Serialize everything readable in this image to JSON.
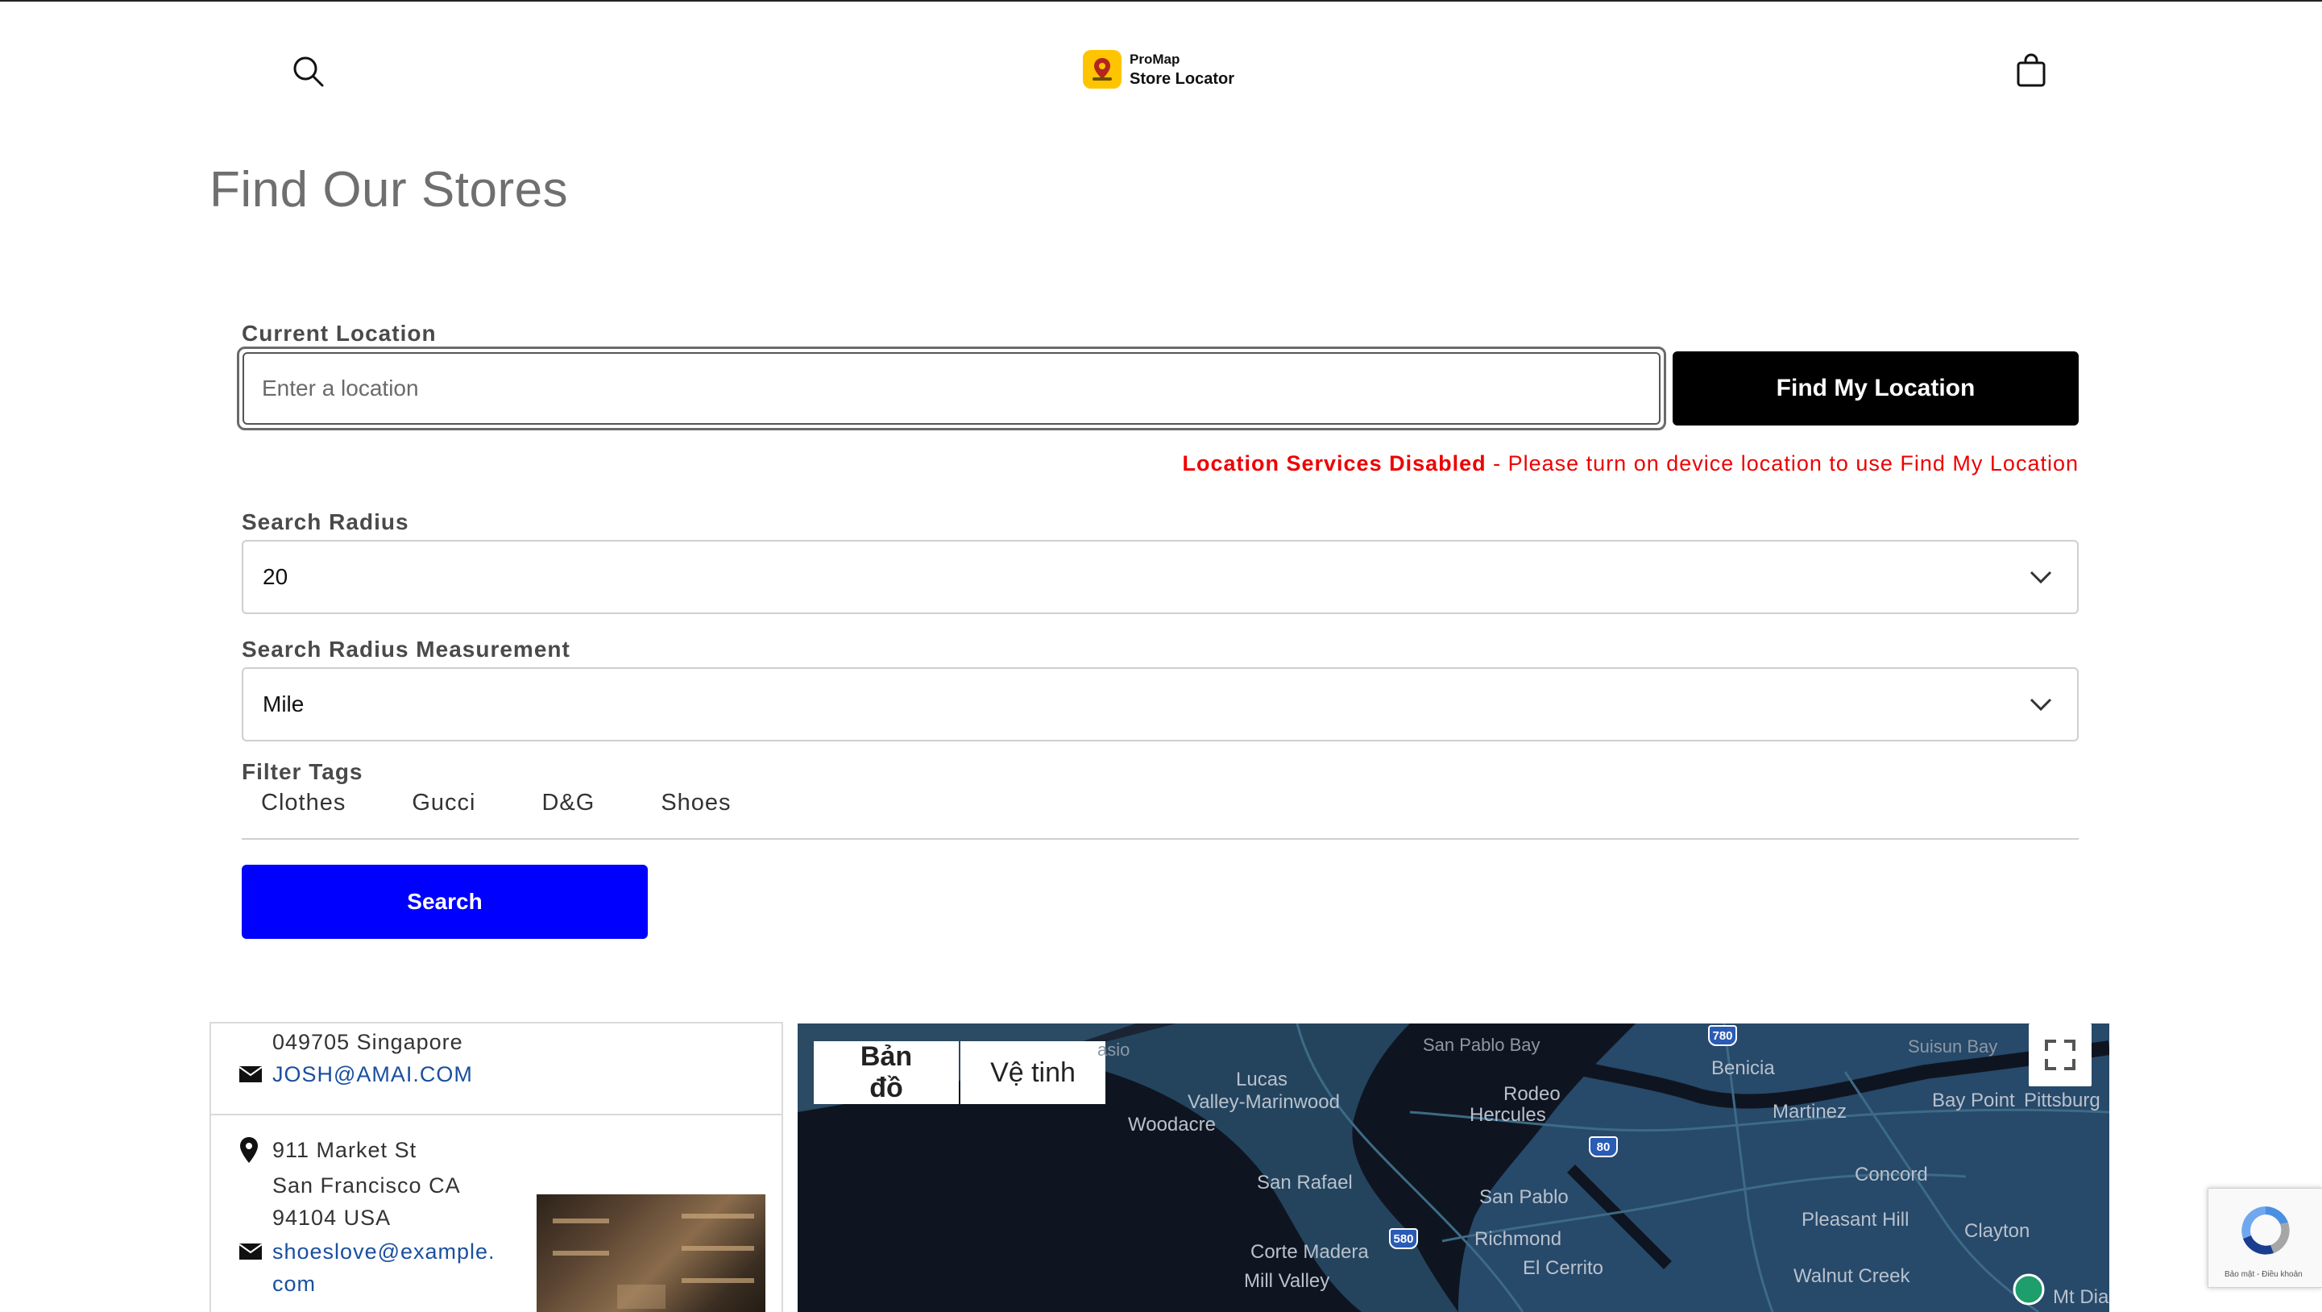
{
  "header": {
    "logo_brand": "ProMap",
    "logo_name": "Store Locator",
    "search_icon": "search-icon",
    "cart_icon": "cart-icon"
  },
  "page": {
    "title": "Find Our Stores"
  },
  "form": {
    "current_location_label": "Current Location",
    "location_placeholder": "Enter a location",
    "location_value": "",
    "find_location_button": "Find My Location",
    "warning_strong": "Location Services Disabled",
    "warning_text": " - Please turn on device location to use Find My Location",
    "warning_color": "#ee0000",
    "radius_label": "Search Radius",
    "radius_value": "20",
    "measurement_label": "Search Radius Measurement",
    "measurement_value": "Mile",
    "filter_label": "Filter Tags",
    "tags": [
      "Clothes",
      "Gucci",
      "D&G",
      "Shoes"
    ],
    "search_button": "Search",
    "search_button_color": "#0000ff"
  },
  "stores": [
    {
      "address_tail": "049705 Singapore",
      "email": "JOSH@AMAI.COM"
    },
    {
      "address_lines": [
        "911 Market St",
        "San Francisco CA",
        "94104 USA"
      ],
      "email_lines": [
        "shoeslove@example.",
        "com"
      ]
    }
  ],
  "map": {
    "tab_map": "Bản đồ",
    "tab_satellite": "Vệ tinh",
    "labels": [
      "asio",
      "San Pablo Bay",
      "Suisun Bay",
      "Lucas",
      "Valley-Marinwood",
      "Woodacre",
      "Benicia",
      "Rodeo",
      "Hercules",
      "Martinez",
      "Bay Point",
      "Pittsburg",
      "San Rafael",
      "San Pablo",
      "Richmond",
      "Concord",
      "Pleasant Hill",
      "Clayton",
      "Corte Madera",
      "Mill Valley",
      "El Cerrito",
      "Walnut Creek",
      "Mt Dia"
    ],
    "highways": [
      "780",
      "80",
      "580"
    ]
  },
  "recaptcha": {
    "terms": "Bảo mật - Điều khoản"
  }
}
